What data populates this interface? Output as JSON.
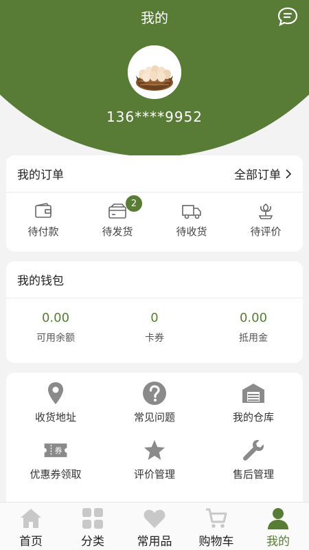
{
  "header": {
    "title": "我的",
    "phone": "136****9952"
  },
  "orders": {
    "title": "我的订单",
    "all_label": "全部订单",
    "items": [
      {
        "label": "待付款",
        "icon": "wallet-icon"
      },
      {
        "label": "待发货",
        "icon": "card-icon",
        "badge": "2"
      },
      {
        "label": "待收货",
        "icon": "truck-icon"
      },
      {
        "label": "待评价",
        "icon": "flower-icon"
      }
    ]
  },
  "wallet": {
    "title": "我的钱包",
    "items": [
      {
        "value": "0.00",
        "label": "可用余额"
      },
      {
        "value": "0",
        "label": "卡券"
      },
      {
        "value": "0.00",
        "label": "抵用金"
      }
    ]
  },
  "services": [
    {
      "label": "收货地址",
      "icon": "location-pin-icon"
    },
    {
      "label": "常见问题",
      "icon": "question-circle-icon"
    },
    {
      "label": "我的仓库",
      "icon": "warehouse-icon"
    },
    {
      "label": "优惠券领取",
      "icon": "coupon-icon",
      "icon_text": "券"
    },
    {
      "label": "评价管理",
      "icon": "star-icon"
    },
    {
      "label": "售后管理",
      "icon": "wrench-icon"
    }
  ],
  "tabbar": [
    {
      "label": "首页",
      "icon": "home-icon"
    },
    {
      "label": "分类",
      "icon": "grid-icon"
    },
    {
      "label": "常用品",
      "icon": "heart-icon"
    },
    {
      "label": "购物车",
      "icon": "cart-icon"
    },
    {
      "label": "我的",
      "icon": "user-icon",
      "active": true
    }
  ],
  "colors": {
    "brand": "#587b35",
    "icon_gray": "#8a8a8a",
    "tab_gray": "#c8c8c8"
  }
}
